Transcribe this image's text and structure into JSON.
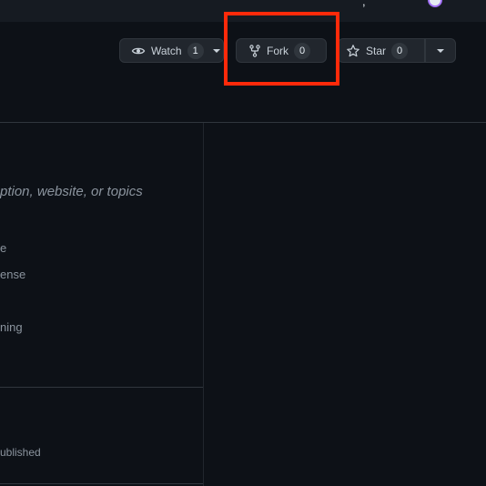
{
  "header": {
    "partial_glyph": ","
  },
  "actions": {
    "watch": {
      "label": "Watch",
      "count": "1"
    },
    "fork": {
      "label": "Fork",
      "count": "0"
    },
    "star": {
      "label": "Star",
      "count": "0"
    }
  },
  "highlight": {
    "color": "#ff2a0a",
    "target": "fork-button"
  },
  "sidebar": {
    "about_placeholder": "ption, website, or topics",
    "items": [
      "e",
      "ense",
      "ning"
    ],
    "releases_text": "ublished"
  },
  "colors": {
    "background": "#0d1117",
    "button_bg": "#21262d",
    "border": "#30363d",
    "muted_text": "#8b949e",
    "annotation_red": "#ff2a0a"
  }
}
